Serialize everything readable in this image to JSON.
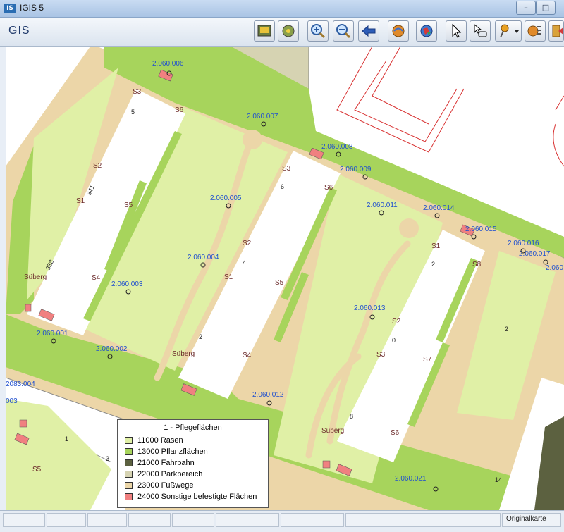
{
  "window": {
    "title": "IGIS 5",
    "icon_text": "IS",
    "min_label": "–",
    "max_label": "□"
  },
  "toolbar": {
    "app_title": "GIS",
    "buttons": [
      {
        "name": "map-print-button",
        "icon": "map-icon"
      },
      {
        "name": "map-settings-button",
        "icon": "gear-icon"
      },
      {
        "name": "zoom-in-button",
        "icon": "zoom-in-icon"
      },
      {
        "name": "zoom-out-button",
        "icon": "zoom-out-icon"
      },
      {
        "name": "back-button",
        "icon": "arrow-left-icon"
      },
      {
        "name": "layers-button",
        "icon": "layers-icon"
      },
      {
        "name": "globe-button",
        "icon": "globe-icon"
      },
      {
        "name": "select-button",
        "icon": "pointer-icon"
      },
      {
        "name": "select-rect-button",
        "icon": "pointer-rect-icon"
      },
      {
        "name": "pin-button",
        "icon": "pin-icon"
      },
      {
        "name": "layer-list-button",
        "icon": "layer-list-icon"
      },
      {
        "name": "exit-button",
        "icon": "exit-icon"
      }
    ]
  },
  "colors": {
    "rasen": "#e0f0a6",
    "pflanz": "#a7d45c",
    "fahrbahn": "#5c6140",
    "park": "#d6d3b2",
    "fussweg": "#ecd6a8",
    "sonstige": "#f08080",
    "label_blue": "#1f4fcf",
    "label_brown": "#6b2a2a"
  },
  "map": {
    "parcels": [
      {
        "id": "p006",
        "text": "2.060.006"
      },
      {
        "id": "p007",
        "text": "2.060.007"
      },
      {
        "id": "p008",
        "text": "2.060.008"
      },
      {
        "id": "p009",
        "text": "2.060.009"
      },
      {
        "id": "p005",
        "text": "2.060.005"
      },
      {
        "id": "p011",
        "text": "2.060.011"
      },
      {
        "id": "p014",
        "text": "2.060.014"
      },
      {
        "id": "p015",
        "text": "2.060.015"
      },
      {
        "id": "p016",
        "text": "2.060.016"
      },
      {
        "id": "p017",
        "text": "2.060.017"
      },
      {
        "id": "p0xx",
        "text": "2.060"
      },
      {
        "id": "p004",
        "text": "2.060.004"
      },
      {
        "id": "p003",
        "text": "2.060.003"
      },
      {
        "id": "p013",
        "text": "2.060.013"
      },
      {
        "id": "p001",
        "text": "2.060.001"
      },
      {
        "id": "p002",
        "text": "2.060.002"
      },
      {
        "id": "p012",
        "text": "2.060.012"
      },
      {
        "id": "p021",
        "text": "2.060.021"
      },
      {
        "id": "p2083",
        "text": "2083.004"
      },
      {
        "id": "p003b",
        "text": "003"
      }
    ],
    "markers": [
      "S3",
      "S6",
      "S2",
      "S1",
      "S5",
      "S4",
      "Süberg",
      "S8",
      "S7",
      "Süberg",
      "S6",
      "S1",
      "S2",
      "S3",
      "S4",
      "S5",
      "S2",
      "S3",
      "S1",
      "S5",
      "S6",
      "S4",
      "Süberg"
    ],
    "numbers": [
      "5",
      "341",
      "338",
      "1",
      "3",
      "14",
      "2",
      "4",
      "6",
      "2",
      "0",
      "8",
      "2"
    ]
  },
  "legend": {
    "title": "1 - Pflegeflächen",
    "items": [
      {
        "label": "11000 Rasen",
        "color": "#e0f0a6"
      },
      {
        "label": "13000 Pflanzflächen",
        "color": "#a7d45c"
      },
      {
        "label": "21000 Fahrbahn",
        "color": "#5c6140"
      },
      {
        "label": "22000 Parkbereich",
        "color": "#d6d3b2"
      },
      {
        "label": "23000 Fußwege",
        "color": "#ecd6a8"
      },
      {
        "label": "24000 Sonstige befestigte Flächen",
        "color": "#f08080"
      }
    ]
  },
  "status": {
    "map_name": "Originalkarte"
  }
}
